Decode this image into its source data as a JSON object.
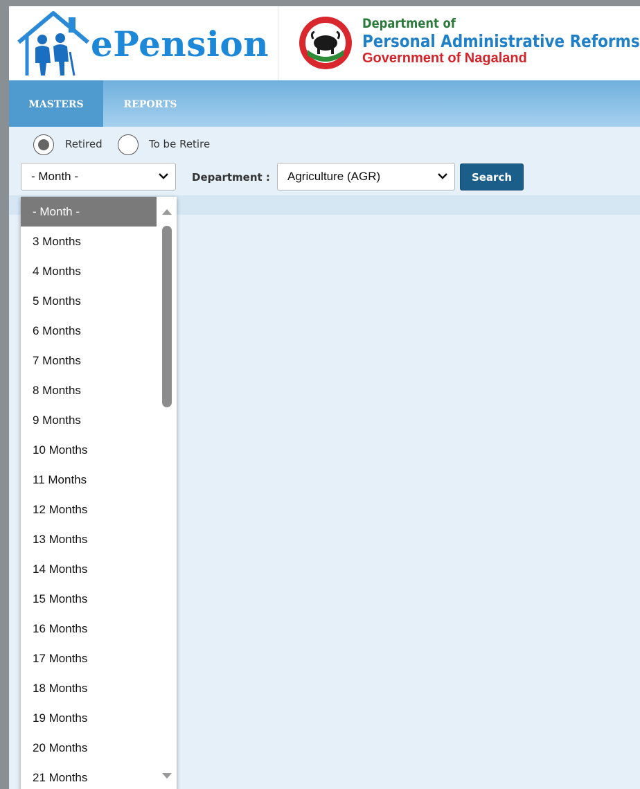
{
  "header": {
    "app_name": "ePension",
    "dept_line1": "Department of",
    "dept_line2": "Personal Administrative Reforms",
    "dept_line3": "Government of Nagaland"
  },
  "nav": {
    "masters": "MASTERS",
    "reports": "REPORTS"
  },
  "filters": {
    "radio_retired": "Retired",
    "radio_to_be_retire": "To be Retire",
    "radio_retired_checked": true,
    "month_selected": "- Month -",
    "department_label": "Department :",
    "department_selected": "Agriculture (AGR)",
    "search_label": "Search"
  },
  "month_dropdown": {
    "options": [
      "- Month -",
      "3 Months",
      "4 Months",
      "5 Months",
      "6 Months",
      "7 Months",
      "8 Months",
      "9 Months",
      "10 Months",
      "11 Months",
      "12 Months",
      "13 Months",
      "14 Months",
      "15 Months",
      "16 Months",
      "17 Months",
      "18 Months",
      "19 Months",
      "20 Months",
      "21 Months"
    ],
    "selected_index": 0
  },
  "colors": {
    "brand_blue": "#1e88d8",
    "nav_active": "#4f9bd0",
    "search_button": "#1b5e8a",
    "dept_green": "#2a7a3c",
    "dept_red": "#d4242a"
  }
}
